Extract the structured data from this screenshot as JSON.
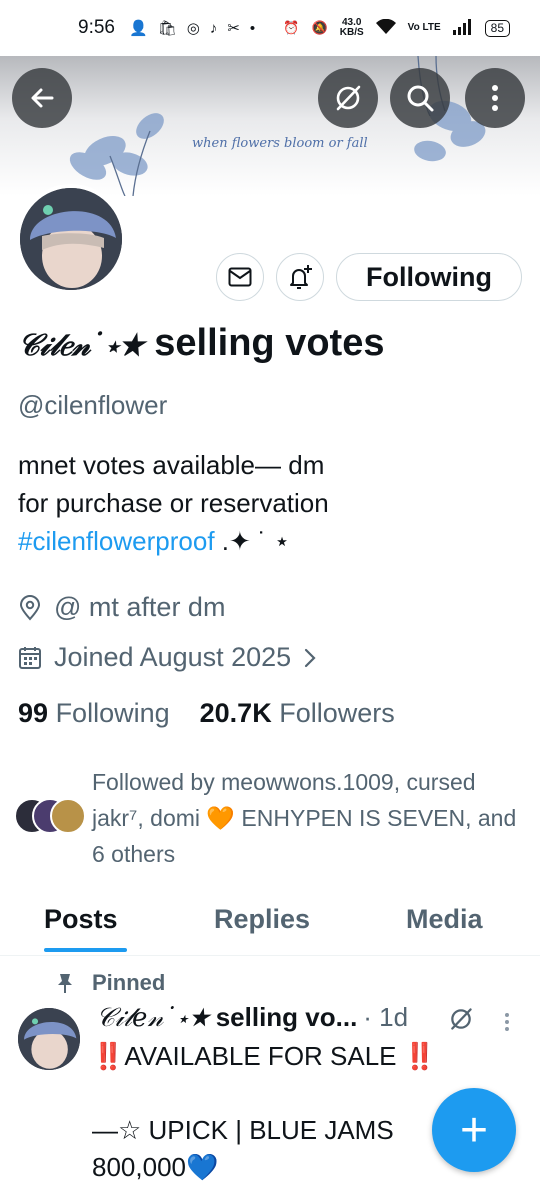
{
  "status_bar": {
    "time": "9:56",
    "net_speed": "43.0",
    "net_unit": "KB/S",
    "volte": "Vo LTE",
    "battery": "85"
  },
  "banner": {
    "text": "when flowers bloom or fall"
  },
  "profile": {
    "display_name_deco": "𝒞𝒾𝓁𝑒𝓃˙⋆★",
    "display_name": "selling votes",
    "handle": "@cilenflower",
    "bio_line1": "mnet votes available— dm",
    "bio_line2": "for purchase or reservation",
    "bio_hashtag": "#cilenflowerproof",
    "bio_sparkles": " .✦ ˙ ⋆",
    "location": "@ mt after dm",
    "joined": "Joined August 2025",
    "following_count": "99",
    "following_label": "Following",
    "followers_count": "20.7K",
    "followers_label": "Followers",
    "followed_by": "Followed by meowwons.1009, cursed jakr⁷, domi 🧡 ENHYPEN IS SEVEN, and 6 others"
  },
  "actions": {
    "following_button": "Following"
  },
  "tabs": [
    "Posts",
    "Replies",
    "Media"
  ],
  "post": {
    "pinned_label": "Pinned",
    "author_deco": "𝒞𝒾𝓁𝑒𝓃˙⋆★",
    "author": "selling vo...",
    "time": "· 1d",
    "body": "‼️AVAILABLE FOR SALE ‼️\n\n—☆ UPICK | BLUE JAMS\n800,000💙"
  },
  "fab_label": "+",
  "colors": {
    "accent": "#1d9bf0",
    "secondary_text": "#536471",
    "primary_text": "#0f1419"
  }
}
